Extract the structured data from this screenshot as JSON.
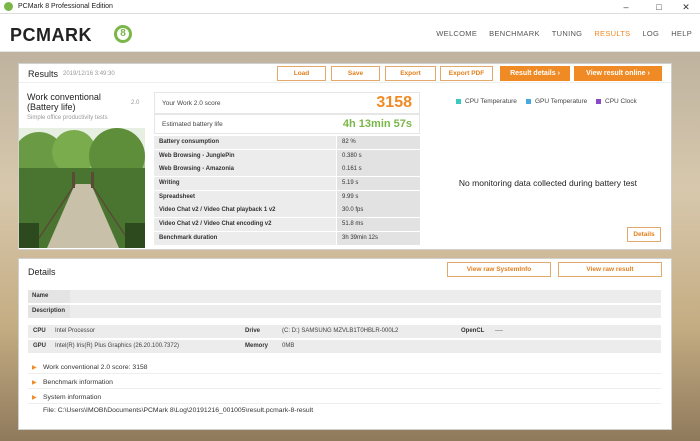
{
  "window": {
    "title": "PCMark 8 Professional Edition"
  },
  "logo": {
    "text": "PCMARK",
    "badge": "8"
  },
  "nav": {
    "items": [
      "WELCOME",
      "BENCHMARK",
      "TUNING",
      "RESULTS",
      "LOG",
      "HELP"
    ],
    "active": "RESULTS"
  },
  "results": {
    "title": "Results",
    "date": "2019/12/16 3:49:30",
    "buttons": {
      "load": "Load",
      "save": "Save",
      "export": "Export",
      "export_pdf": "Export PDF",
      "result_details": "Result details",
      "view_online": "View result online"
    },
    "test": {
      "name": "Work conventional (Battery life)",
      "version": "2.0",
      "subtitle": "Simple office productivity tests"
    },
    "score_label": "Your Work 2.0 score",
    "score_value": "3158",
    "battery_label": "Estimated battery life",
    "battery_value": "4h 13min 57s",
    "metrics": [
      {
        "k": "Battery consumption",
        "v": "82 %"
      },
      {
        "k": "Web Browsing - JunglePin",
        "v": "0.380 s"
      },
      {
        "k": "Web Browsing - Amazonia",
        "v": "0.161 s"
      },
      {
        "k": "Writing",
        "v": "5.19 s"
      },
      {
        "k": "Spreadsheet",
        "v": "9.99 s"
      },
      {
        "k": "Video Chat v2 / Video Chat playback 1 v2",
        "v": "30.0 fps"
      },
      {
        "k": "Video Chat v2 / Video Chat encoding v2",
        "v": "51.8 ms"
      },
      {
        "k": "Benchmark duration",
        "v": "3h 39min 12s"
      }
    ],
    "legend": [
      {
        "label": "CPU Temperature",
        "color": "#3cc8c0"
      },
      {
        "label": "GPU Temperature",
        "color": "#4aa8e0"
      },
      {
        "label": "CPU Clock",
        "color": "#8a4ac8"
      }
    ],
    "no_data": "No monitoring data collected during battery test",
    "details_button": "Details"
  },
  "details": {
    "title": "Details",
    "view_sysinfo": "View raw SystemInfo",
    "view_result": "View raw result",
    "name_label": "Name",
    "description_label": "Description",
    "cpu_label": "CPU",
    "cpu_value": "Intel Processor",
    "gpu_label": "GPU",
    "gpu_value": "Intel(R) Iris(R) Plus Graphics (26.20.100.7372)",
    "drive_label": "Drive",
    "drive_value": "(C: D:) SAMSUNG MZVLB1T0HBLR-000L2",
    "memory_label": "Memory",
    "memory_value": "0MB",
    "opencl_label": "OpenCL",
    "opencl_value": "----",
    "expanders": [
      "Work conventional 2.0 score: 3158",
      "Benchmark information",
      "System information"
    ],
    "file": "File: C:\\Users\\IMOBI\\Documents\\PCMark 8\\Log\\20191216_001005\\result.pcmark-8-result"
  }
}
